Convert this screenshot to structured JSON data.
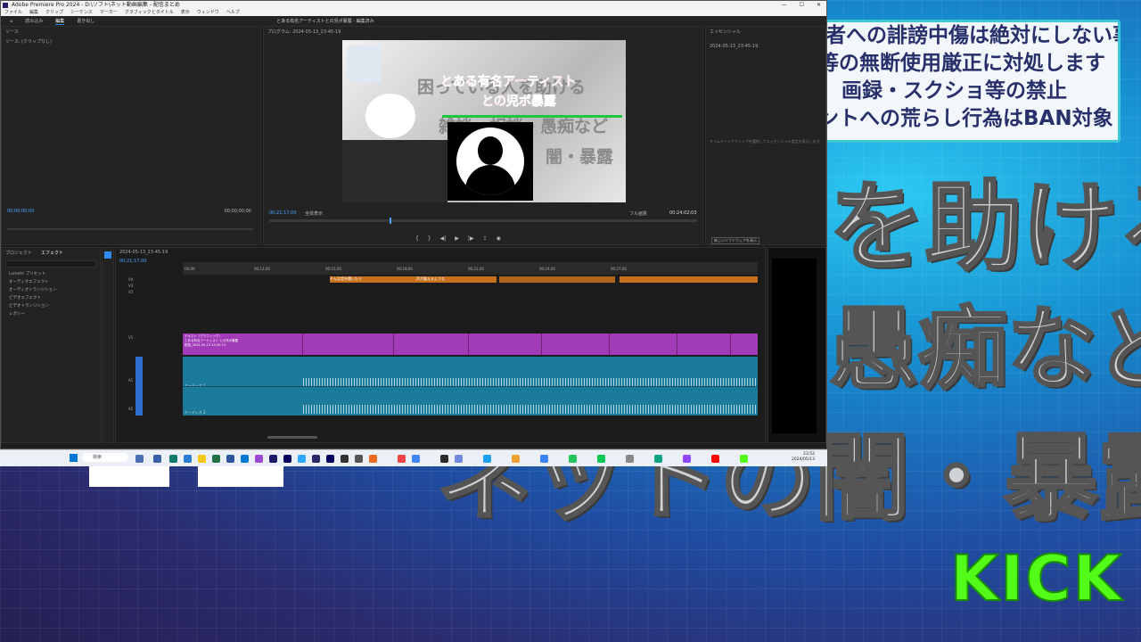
{
  "stream": {
    "notice_lines": [
      "者への誹謗中傷は絶対にしない事",
      "等の無断使用厳正に対処します",
      "画録・スクショ等の禁止",
      "ントへの荒らし行為はBAN対象"
    ],
    "big_line_1": "を助ける",
    "big_line_2": "愚痴など",
    "big_line_3": "ネットの闇・暴露",
    "kick_logo": "KICK",
    "colors": {
      "kick": "#53fc18",
      "notice_border": "#3cc8d6",
      "bg_cyan": "#2cc9f2",
      "bg_purple": "#2b2a6c"
    }
  },
  "premiere": {
    "window_title": "Adobe Premiere Pro 2024 - D:\\ソフト\\ネット動画編集 - 配信まとめ",
    "center_title": "とある有名アーティストとの児ポ暴露 - 編集済み",
    "menu": [
      "ファイル",
      "編集",
      "クリップ",
      "シーケンス",
      "マーカー",
      "グラフィックとタイトル",
      "表示",
      "ウィンドウ",
      "ヘルプ"
    ],
    "workspace_tabs": [
      "読み込み",
      "編集",
      "書き出し"
    ],
    "source_panel_title": "ソース",
    "source_clip": "ソース: (クリップなし)",
    "source_timecode_left": "00;00;00;00",
    "source_timecode_right": "00;00;00;00",
    "program_panel_title": "プログラム: 2024-05-13_23-45-19",
    "program_timecode": "00;21;17;00",
    "program_fit": "全体表示",
    "program_quality": "フル画質",
    "program_duration": "00;24;02;03",
    "effects_panel_title": "エッセンシャル",
    "effects_item": "2024-05-13_23-45-19",
    "effects_message": "タイムラインでクリップを選択してエッセンシャル設定を表示します。",
    "effects_button": "新しいソフトウェアを表示",
    "project_panel_title": "プロジェクト",
    "effects_tab": "エフェクト",
    "bins": [
      "Lumetri プリセット",
      "オーディオエフェクト",
      "オーディオトランジション",
      "ビデオエフェクト",
      "ビデオトランジション",
      "レガシー"
    ],
    "timeline_title": "2024-05-13_23-45-19",
    "timeline_timecode": "00;21;17;00",
    "ruler_labels": [
      "00;00",
      "00;12;00",
      "00;15;00",
      "00;18;00",
      "00;21;00",
      "00;24;00",
      "00;27;00"
    ],
    "tracks_video": [
      "V4",
      "V3",
      "V2",
      "V1"
    ],
    "tracks_audio": [
      "A1",
      "A2",
      "A3"
    ],
    "clip_label_top": "テキスト",
    "clip_label_purple_1": "テキスト（グラフィック）",
    "clip_label_purple_2": "とある有名アーティスト との児ポ暴露",
    "clip_label_purple_3": "配信_2024-05-13 23:45:19",
    "clip_label_audio_1": "オーディオ 1",
    "clip_label_audio_2": "オーディオ 2",
    "clip_orange_label": "そんな話を聞いたら",
    "clip_orange_label_2": "声が震えるような",
    "program_overlay_text_1": "とある有名アーティスト",
    "program_overlay_text_2": "との児ポ暴露",
    "program_bg_text_1": "困っている人を助ける",
    "program_bg_text_2": "雑談・相談・愚痴など",
    "program_bg_text_3": "闇・暴露",
    "taskbar_search": "検索",
    "taskbar_time": "23:52",
    "taskbar_date": "2024/05/13"
  }
}
